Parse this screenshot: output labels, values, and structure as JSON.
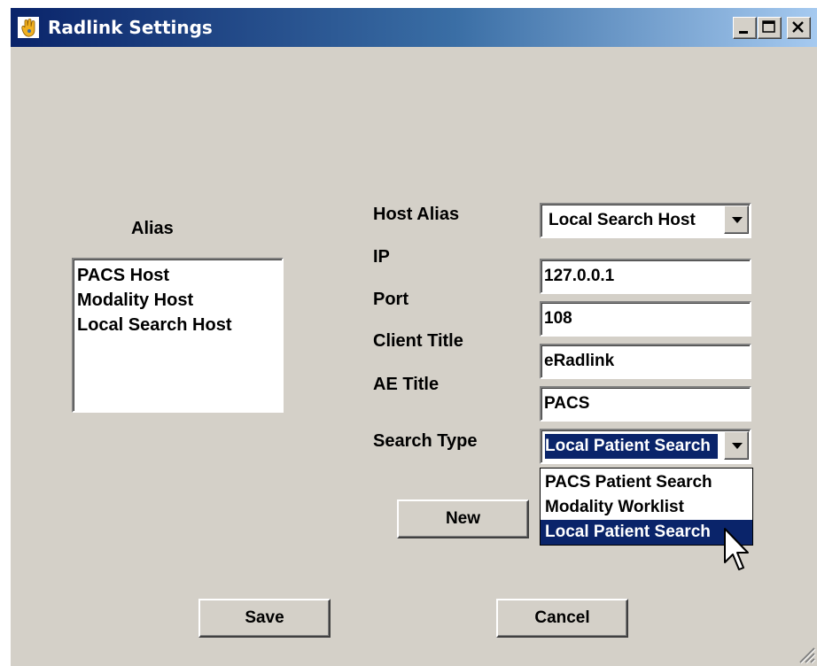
{
  "window": {
    "title": "Radlink Settings",
    "icon": "radlink-hand-icon",
    "controls": [
      "minimize-icon",
      "maximize-icon",
      "close-icon"
    ]
  },
  "alias": {
    "label": "Alias",
    "items": [
      "PACS Host",
      "Modality Host",
      "Local Search Host"
    ]
  },
  "form": {
    "host_alias_label": "Host Alias",
    "host_alias_value": "Local Search Host",
    "ip_label": "IP",
    "ip_value": "127.0.0.1",
    "port_label": "Port",
    "port_value": "108",
    "client_title_label": "Client Title",
    "client_title_value": "eRadlink",
    "ae_title_label": "AE Title",
    "ae_title_value": "PACS",
    "search_type_label": "Search Type",
    "search_type_value": "Local Patient Search",
    "search_type_options": [
      "PACS Patient Search",
      "Modality Worklist",
      "Local Patient Search"
    ]
  },
  "buttons": {
    "new": "New",
    "save": "Save",
    "cancel": "Cancel"
  },
  "colors": {
    "dialog_bg": "#d4d0c8",
    "title_gradient_start": "#0a246a",
    "title_gradient_end": "#a6caf0",
    "selection": "#0a246a"
  }
}
